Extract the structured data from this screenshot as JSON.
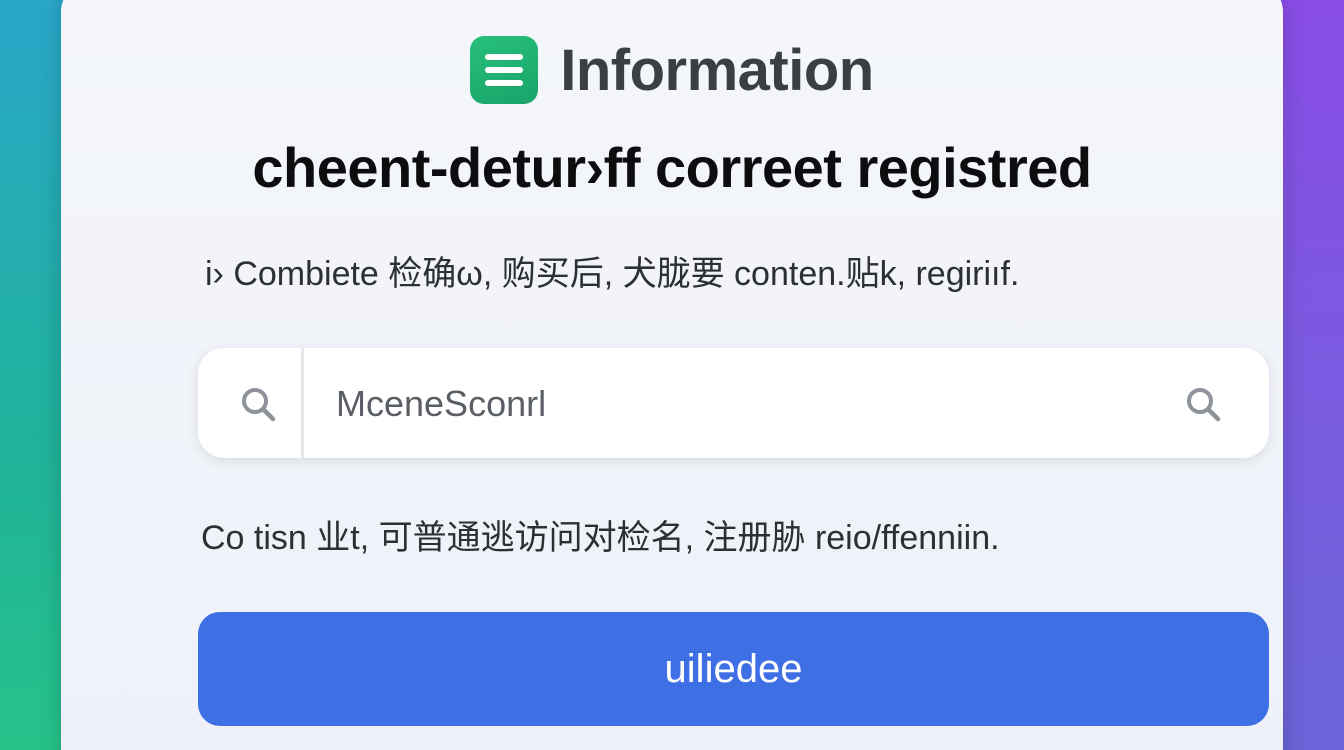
{
  "header": {
    "logo_icon": "list-icon",
    "app_title": "Information"
  },
  "main": {
    "headline": "cheent-detur›ff correet registred",
    "description": "i› Combiete 检确ω, 购买后, 犬胧要 conten.贴k, regiriıf.",
    "search": {
      "value": "MceneSconrl",
      "left_icon": "search-icon",
      "right_icon": "search-icon"
    },
    "note": "Co tisn 业t, 可普通逃访问对检名, 注册胁 reio/ffenniin.",
    "button_label": "uiliedee"
  },
  "colors": {
    "accent_button": "#3f6fe4",
    "logo_green": "#22b573",
    "card_background": "#f1f4f9",
    "background_left": "#1fb39a",
    "background_right": "#8a4de0"
  }
}
